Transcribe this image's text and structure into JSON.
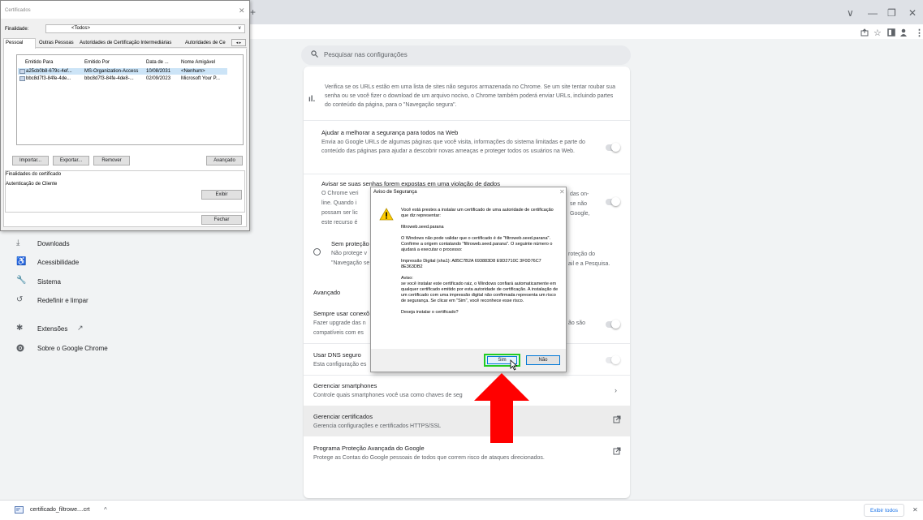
{
  "chrome": {
    "new_tab_glyph": "+",
    "window_controls": [
      "∨",
      "—",
      "❐",
      "✕"
    ],
    "toolbar_icons": [
      "share-icon",
      "star-icon",
      "sidebar-icon",
      "profile-icon",
      "menu-icon"
    ]
  },
  "settings": {
    "search_placeholder": "Pesquisar nas configurações",
    "nav": [
      {
        "icon": "download-icon",
        "label": "Downloads"
      },
      {
        "icon": "accessibility-icon",
        "label": "Acessibilidade"
      },
      {
        "icon": "wrench-icon",
        "label": "Sistema"
      },
      {
        "icon": "reset-icon",
        "label": "Redefinir e limpar"
      },
      {
        "icon": "puzzle-icon",
        "label": "Extensões"
      },
      {
        "icon": "chrome-icon",
        "label": "Sobre o Google Chrome"
      }
    ],
    "safebrowsing_text": "Verifica se os URLs estão em uma lista de sites não seguros armazenada no Chrome. Se um site tentar roubar sua senha ou se você fizer o download de um arquivo nocivo, o Chrome também poderá enviar URLs, incluindo partes do conteúdo da página, para o \"Navegação segura\".",
    "help_title": "Ajudar a melhorar a segurança para todos na Web",
    "help_text": "Envia ao Google URLs de algumas páginas que você visita, informações do sistema limitadas e parte do conteúdo das páginas para ajudar a descobrir novas ameaças e proteger todos os usuários na Web.",
    "warn_title": "Avisar se suas senhas forem expostas em uma violação de dados",
    "warn_left": [
      "O Chrome veri",
      "line. Quando i",
      "possam ser lic",
      "este recurso é"
    ],
    "warn_right": [
      "das on-",
      "se não",
      "Google,",
      ""
    ],
    "noprot_title": "Sem proteção",
    "noprot_left": [
      "Não protege v",
      "\"Navegação se"
    ],
    "noprot_right": [
      "roteção do",
      "ail e a Pesquisa."
    ],
    "advanced_heading": "Avançado",
    "https_left": [
      "Sempre usar conexõ",
      "Fazer upgrade das n",
      "compatíveis com es"
    ],
    "https_right": "ão são",
    "dns_title": "Usar DNS seguro",
    "dns_text": "Esta configuração es",
    "phones_title": "Gerenciar smartphones",
    "phones_text": "Controle quais smartphones você usa como chaves de seg",
    "certs_title": "Gerenciar certificados",
    "certs_text": "Gerencia configurações e certificados HTTPS/SSL",
    "apg_title": "Programa Proteção Avançada do Google",
    "apg_text": "Protege as Contas do Google pessoais de todos que correm risco de ataques direcionados."
  },
  "cert_dialog": {
    "title": "Certificados",
    "purpose_label": "Finalidade:",
    "purpose_value": "<Todos>",
    "tabs": [
      "Pessoal",
      "Outras Pessoas",
      "Autoridades de Certificação Intermediárias",
      "Autoridades de Ce"
    ],
    "columns": [
      "Emitido Para",
      "Emitido Por",
      "Data de ...",
      "Nome Amigável"
    ],
    "rows": [
      [
        "a25cb0b8-679c-4ef...",
        "MS-Organization-Access",
        "10/08/2031",
        "<Nenhum>"
      ],
      [
        "bbc8d7f3-84fe-4de...",
        "bbc8d7f3-84fe-4de8-...",
        "02/09/2023",
        "Microsoft Your P..."
      ]
    ],
    "btn_import": "Importar...",
    "btn_export": "Exportar...",
    "btn_remove": "Remover",
    "btn_advanced": "Avançado",
    "purposes_label": "Finalidades do certificado",
    "purposes_value": "Autenticação de Cliente",
    "btn_view": "Exibir",
    "btn_close": "Fechar"
  },
  "security_dialog": {
    "title": "Aviso de Segurança",
    "p1": "Você está prestes a instalar um certificado de uma autoridade de certificação que diz representar:",
    "p2": "filtroweb.seed.parana",
    "p3": "O Windows não pode validar que o certificado é de \"filtroweb.seed.parana\". Confirme a origem contatando \"filtroweb.seed.parana\". O seguinte número o ajudará a executar o processo:",
    "p4": "Impressão Digital (sha1): A85C7B2A 693883D8 E9D2710C 3F0D76C7 8E363DB2",
    "p5": "Aviso:\nse você instalar este certificado raiz, o Windows confiará automaticamente em qualquer certificado emitido por esta autoridade de certificação. A instalação de um certificado com uma impressão digital não confirmada representa um risco de segurança. Se clicar em \"Sim\", você reconhece esse risco.",
    "p6": "Deseja instalar o certificado?",
    "btn_yes": "Sim",
    "btn_no": "Não"
  },
  "download_bar": {
    "filename": "certificado_filtrowe....crt",
    "show_all": "Exibir todos"
  }
}
